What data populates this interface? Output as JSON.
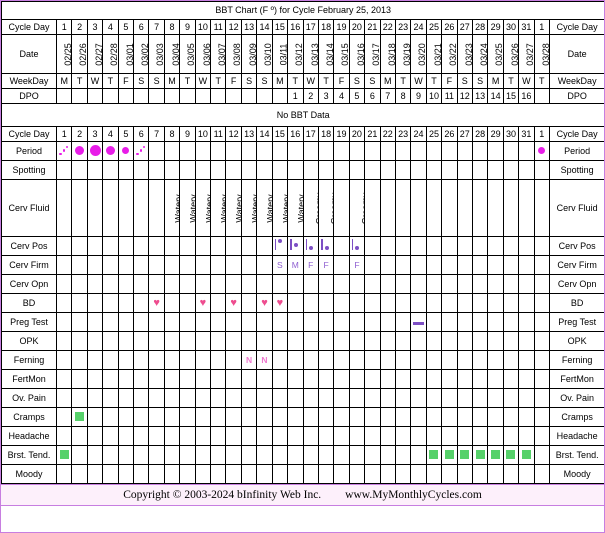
{
  "chart": {
    "title": "BBT Chart (F º) for Cycle February 25, 2013",
    "no_data_banner": "No BBT Data"
  },
  "colors": {
    "accent_border": "#c77ee0",
    "header_bg": "#fdf0fb",
    "period": "#e81ce8",
    "cervix": "#7d4fc4",
    "bd_heart": "#ee4d8f",
    "ferning": "#f07ad0",
    "symptom": "#56d16a",
    "date_bg": "#f8f5e6",
    "daynum_bg": "#f2f2f2"
  },
  "row_labels": {
    "cycle_day": "Cycle Day",
    "date": "Date",
    "weekday": "WeekDay",
    "dpo": "DPO",
    "period": "Period",
    "spotting": "Spotting",
    "cerv_fluid": "Cerv Fluid",
    "cerv_pos": "Cerv Pos",
    "cerv_firm": "Cerv Firm",
    "cerv_opn": "Cerv Opn",
    "bd": "BD",
    "preg_test": "Preg Test",
    "opk": "OPK",
    "ferning": "Ferning",
    "fertmon": "FertMon",
    "ov_pain": "Ov. Pain",
    "cramps": "Cramps",
    "headache": "Headache",
    "brst_tend": "Brst. Tend.",
    "moody": "Moody"
  },
  "columns": {
    "cycle_day": [
      "1",
      "2",
      "3",
      "4",
      "5",
      "6",
      "7",
      "8",
      "9",
      "10",
      "11",
      "12",
      "13",
      "14",
      "15",
      "16",
      "17",
      "18",
      "19",
      "20",
      "21",
      "22",
      "23",
      "24",
      "25",
      "26",
      "27",
      "28",
      "29",
      "30",
      "31",
      "1"
    ],
    "date": [
      "02/25",
      "02/26",
      "02/27",
      "02/28",
      "03/01",
      "03/02",
      "03/03",
      "03/04",
      "03/05",
      "03/06",
      "03/07",
      "03/08",
      "03/09",
      "03/10",
      "03/11",
      "03/12",
      "03/13",
      "03/14",
      "03/15",
      "03/16",
      "03/17",
      "03/18",
      "03/19",
      "03/20",
      "03/21",
      "03/22",
      "03/23",
      "03/24",
      "03/25",
      "03/26",
      "03/27",
      "03/28"
    ],
    "weekday": [
      "M",
      "T",
      "W",
      "T",
      "F",
      "S",
      "S",
      "M",
      "T",
      "W",
      "T",
      "F",
      "S",
      "S",
      "M",
      "T",
      "W",
      "T",
      "F",
      "S",
      "S",
      "M",
      "T",
      "W",
      "T",
      "F",
      "S",
      "S",
      "M",
      "T",
      "W",
      "T"
    ],
    "dpo": [
      "",
      "",
      "",
      "",
      "",
      "",
      "",
      "",
      "",
      "",
      "",
      "",
      "",
      "",
      "",
      "1",
      "2",
      "3",
      "4",
      "5",
      "6",
      "7",
      "8",
      "9",
      "10",
      "11",
      "12",
      "13",
      "14",
      "15",
      "16",
      ""
    ]
  },
  "rows": {
    "period": [
      "spot",
      "blob-l",
      "blob-xl",
      "blob-l",
      "blob-m",
      "spot",
      "",
      "",
      "",
      "",
      "",
      "",
      "",
      "",
      "",
      "",
      "",
      "",
      "",
      "",
      "",
      "",
      "",
      "",
      "",
      "",
      "",
      "",
      "",
      "",
      "",
      "blob-m"
    ],
    "spotting": [
      "",
      "",
      "",
      "",
      "",
      "",
      "",
      "",
      "",
      "",
      "",
      "",
      "",
      "",
      "",
      "",
      "",
      "",
      "",
      "",
      "",
      "",
      "",
      "",
      "",
      "",
      "",
      "",
      "",
      "",
      "",
      ""
    ],
    "cerv_fluid": [
      "",
      "",
      "",
      "",
      "",
      "",
      "",
      "Watery",
      "Watery",
      "Watery",
      "Watery",
      "Watery",
      "Watery",
      "Watery",
      "Watery",
      "Watery",
      "Creamy",
      "Creamy",
      "",
      "Creamy",
      "",
      "",
      "",
      "",
      "",
      "",
      "",
      "",
      "",
      "",
      "",
      ""
    ],
    "cerv_pos": [
      "",
      "",
      "",
      "",
      "",
      "",
      "",
      "",
      "",
      "",
      "",
      "",
      "",
      "",
      "high",
      "mid",
      "low",
      "low",
      "",
      "low",
      "",
      "",
      "",
      "",
      "",
      "",
      "",
      "",
      "",
      "",
      "",
      ""
    ],
    "cerv_firm": [
      "",
      "",
      "",
      "",
      "",
      "",
      "",
      "",
      "",
      "",
      "",
      "",
      "",
      "",
      "S",
      "M",
      "F",
      "F",
      "",
      "F",
      "",
      "",
      "",
      "",
      "",
      "",
      "",
      "",
      "",
      "",
      "",
      ""
    ],
    "cerv_opn": [
      "",
      "",
      "",
      "",
      "",
      "",
      "",
      "",
      "",
      "",
      "",
      "",
      "",
      "",
      "",
      "",
      "",
      "",
      "",
      "",
      "",
      "",
      "",
      "",
      "",
      "",
      "",
      "",
      "",
      "",
      "",
      ""
    ],
    "bd": [
      "",
      "",
      "",
      "",
      "",
      "",
      "heart",
      "",
      "",
      "heart",
      "",
      "heart",
      "",
      "heart",
      "heart",
      "",
      "",
      "",
      "",
      "",
      "",
      "",
      "",
      "",
      "",
      "",
      "",
      "",
      "",
      "",
      "",
      ""
    ],
    "preg_test": [
      "",
      "",
      "",
      "",
      "",
      "",
      "",
      "",
      "",
      "",
      "",
      "",
      "",
      "",
      "",
      "",
      "",
      "",
      "",
      "",
      "",
      "",
      "",
      "neg",
      "",
      "",
      "",
      "",
      "",
      "",
      "",
      ""
    ],
    "opk": [
      "",
      "",
      "",
      "",
      "",
      "",
      "",
      "",
      "",
      "",
      "",
      "",
      "",
      "",
      "",
      "",
      "",
      "",
      "",
      "",
      "",
      "",
      "",
      "",
      "",
      "",
      "",
      "",
      "",
      "",
      "",
      ""
    ],
    "ferning": [
      "",
      "",
      "",
      "",
      "",
      "",
      "",
      "",
      "",
      "",
      "",
      "",
      "N",
      "N",
      "",
      "",
      "",
      "",
      "",
      "",
      "",
      "",
      "",
      "",
      "",
      "",
      "",
      "",
      "",
      "",
      "",
      ""
    ],
    "fertmon": [
      "",
      "",
      "",
      "",
      "",
      "",
      "",
      "",
      "",
      "",
      "",
      "",
      "",
      "",
      "",
      "",
      "",
      "",
      "",
      "",
      "",
      "",
      "",
      "",
      "",
      "",
      "",
      "",
      "",
      "",
      "",
      ""
    ],
    "ov_pain": [
      "",
      "",
      "",
      "",
      "",
      "",
      "",
      "",
      "",
      "",
      "",
      "",
      "",
      "",
      "",
      "",
      "",
      "",
      "",
      "",
      "",
      "",
      "",
      "",
      "",
      "",
      "",
      "",
      "",
      "",
      "",
      ""
    ],
    "cramps": [
      "",
      "green",
      "",
      "",
      "",
      "",
      "",
      "",
      "",
      "",
      "",
      "",
      "",
      "",
      "",
      "",
      "",
      "",
      "",
      "",
      "",
      "",
      "",
      "",
      "",
      "",
      "",
      "",
      "",
      "",
      "",
      ""
    ],
    "headache": [
      "",
      "",
      "",
      "",
      "",
      "",
      "",
      "",
      "",
      "",
      "",
      "",
      "",
      "",
      "",
      "",
      "",
      "",
      "",
      "",
      "",
      "",
      "",
      "",
      "",
      "",
      "",
      "",
      "",
      "",
      "",
      ""
    ],
    "brst_tend": [
      "green",
      "",
      "",
      "",
      "",
      "",
      "",
      "",
      "",
      "",
      "",
      "",
      "",
      "",
      "",
      "",
      "",
      "",
      "",
      "",
      "",
      "",
      "",
      "",
      "green",
      "green",
      "green",
      "green",
      "green",
      "green",
      "green",
      ""
    ],
    "moody": [
      "",
      "",
      "",
      "",
      "",
      "",
      "",
      "",
      "",
      "",
      "",
      "",
      "",
      "",
      "",
      "",
      "",
      "",
      "",
      "",
      "",
      "",
      "",
      "",
      "",
      "",
      "",
      "",
      "",
      "",
      "",
      ""
    ]
  },
  "footer": {
    "copyright": "Copyright © 2003-2024 bInfinity Web Inc.",
    "website": "www.MyMonthlyCycles.com"
  }
}
